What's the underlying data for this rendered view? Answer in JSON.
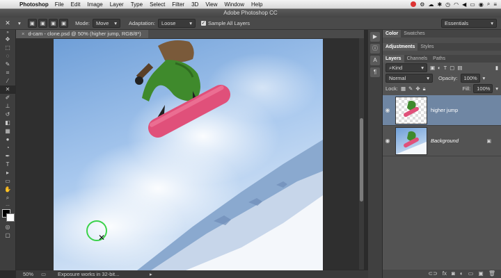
{
  "menubar": {
    "app": "Photoshop",
    "items": [
      "File",
      "Edit",
      "Image",
      "Layer",
      "Type",
      "Select",
      "Filter",
      "3D",
      "View",
      "Window",
      "Help"
    ]
  },
  "window": {
    "title": "Adobe Photoshop CC"
  },
  "options": {
    "mode_label": "Mode:",
    "mode_value": "Move",
    "adaptation_label": "Adaptation:",
    "adaptation_value": "Loose",
    "sample_all_layers": "Sample All Layers",
    "workspace": "Essentials"
  },
  "document": {
    "tab_title": "d-cam - clone.psd @ 50% (higher jump, RGB/8*)",
    "zoom": "50%",
    "status_text": "Exposure works in 32-bit..."
  },
  "panels": {
    "top_tabs": [
      "Color",
      "Swatches"
    ],
    "mid_tabs": [
      "Adjustments",
      "Styles"
    ],
    "layer_tabs": [
      "Layers",
      "Channels",
      "Paths"
    ],
    "kind_filter": "Kind",
    "blend_mode": "Normal",
    "opacity_label": "Opacity:",
    "opacity_value": "100%",
    "lock_label": "Lock:",
    "fill_label": "Fill:",
    "fill_value": "100%",
    "layers": [
      {
        "name": "higher jump",
        "selected": true
      },
      {
        "name": "Background",
        "selected": false
      }
    ]
  },
  "colors": {
    "selection": "#6f86a3",
    "board": "#e0507a",
    "sky": "#7aa6dc"
  }
}
